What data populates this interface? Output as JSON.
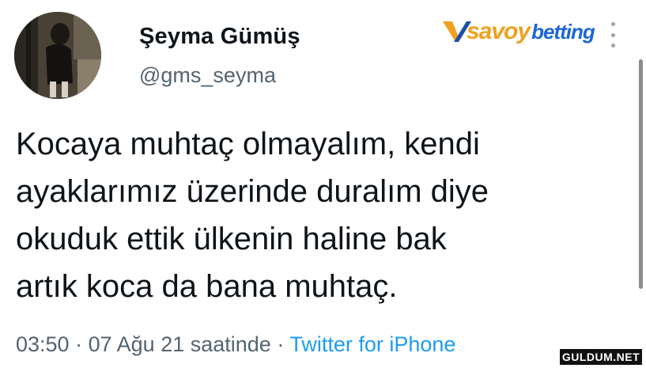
{
  "author": {
    "display_name": "Şeyma Gümüş",
    "handle": "@gms_seyma"
  },
  "tweet": {
    "lines": [
      "Kocaya muhtaç olmayalım, kendi",
      "ayaklarımız üzerinde duralım diye",
      "okuduk ettik ülkenin haline bak",
      "artık koca da bana muhtaç."
    ]
  },
  "meta": {
    "time": "03:50",
    "separator": "·",
    "date": "07 Ağu 21 saatinde",
    "source": "Twitter for iPhone"
  },
  "watermark": {
    "brand_part1": "savoy",
    "brand_part2": "betting",
    "site": "GULDUM.NET"
  },
  "icons": {
    "more": "more-vertical-icon",
    "brand_logo": "v-logo-icon"
  },
  "colors": {
    "text": "#0f1419",
    "muted": "#536471",
    "link": "#1d9bf0",
    "brand_orange": "#f0a020",
    "brand_blue": "#1d66d8"
  }
}
